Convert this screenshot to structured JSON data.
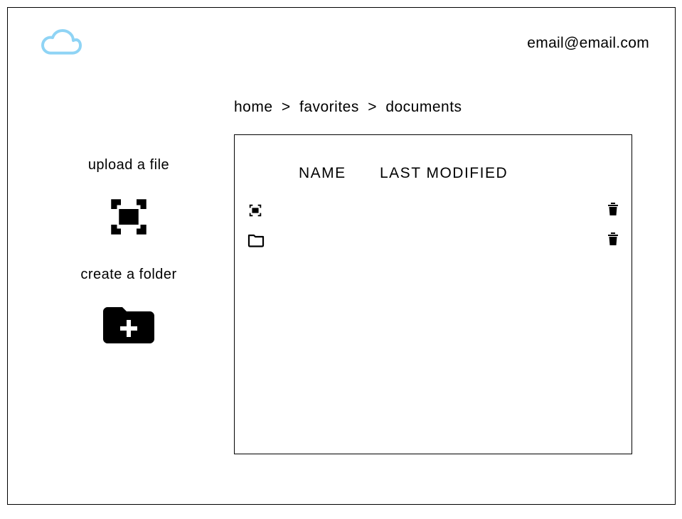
{
  "header": {
    "user_email": "email@email.com"
  },
  "breadcrumb": {
    "items": [
      "home",
      "favorites",
      "documents"
    ],
    "separator": ">"
  },
  "sidebar": {
    "upload_label": "upload a file",
    "create_folder_label": "create a folder"
  },
  "table": {
    "columns": {
      "name": "NAME",
      "modified": "LAST MODIFIED"
    },
    "rows": [
      {
        "type": "image",
        "name": "",
        "modified": ""
      },
      {
        "type": "folder",
        "name": "",
        "modified": ""
      }
    ]
  },
  "icons": {
    "cloud": "cloud-icon",
    "upload": "image-placeholder-icon",
    "create_folder": "folder-plus-icon",
    "row_image": "image-placeholder-icon",
    "row_folder": "folder-icon",
    "trash": "trash-icon"
  }
}
